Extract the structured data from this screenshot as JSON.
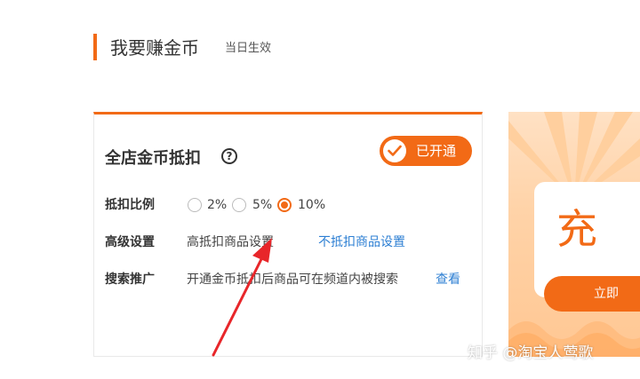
{
  "section": {
    "title": "我要赚金币",
    "subtitle": "当日生效"
  },
  "card": {
    "title": "全店金币抵扣",
    "help_icon": "question-circle-icon",
    "status": {
      "label": "已开通",
      "icon": "check-circle-icon"
    },
    "rows": {
      "ratio": {
        "label": "抵扣比例",
        "options": [
          {
            "label": "2%",
            "checked": false
          },
          {
            "label": "5%",
            "checked": false
          },
          {
            "label": "10%",
            "checked": true
          }
        ]
      },
      "advanced": {
        "label": "高级设置",
        "option_high": "高抵扣商品设置",
        "option_none": "不抵扣商品设置"
      },
      "search": {
        "label": "搜索推广",
        "text": "开通金币抵扣后商品可在频道内被搜索",
        "link": "查看"
      }
    }
  },
  "promo": {
    "big_text": "充",
    "button_label": "立即"
  },
  "watermark": "知乎 @淘宝人莺歌",
  "colors": {
    "accent": "#f26a16",
    "link": "#2d7fd3"
  }
}
